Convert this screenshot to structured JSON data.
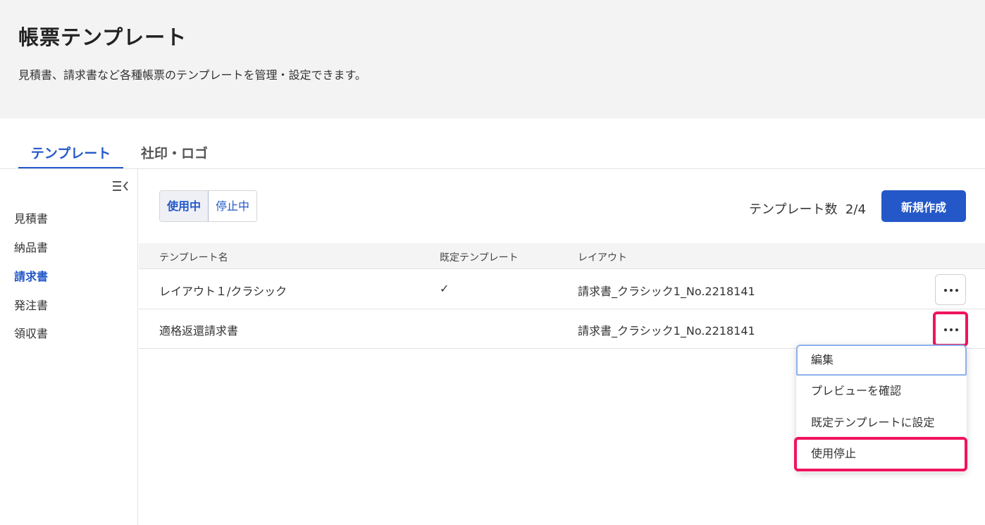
{
  "page": {
    "title": "帳票テンプレート",
    "description": "見積書、請求書など各種帳票のテンプレートを管理・設定できます。"
  },
  "tabs": [
    {
      "label": "テンプレート",
      "active": true
    },
    {
      "label": "社印・ロゴ",
      "active": false
    }
  ],
  "sidebar": {
    "collapse_icon": "collapse-sidebar-icon",
    "items": [
      {
        "label": "見積書",
        "active": false
      },
      {
        "label": "納品書",
        "active": false
      },
      {
        "label": "請求書",
        "active": true
      },
      {
        "label": "発注書",
        "active": false
      },
      {
        "label": "領収書",
        "active": false
      }
    ]
  },
  "status_toggle": {
    "active_label": "使用中",
    "inactive_label": "停止中",
    "selected": "使用中"
  },
  "template_count": {
    "label": "テンプレート数",
    "value": "2/4"
  },
  "new_button": {
    "label": "新規作成"
  },
  "table": {
    "columns": [
      "テンプレート名",
      "既定テンプレート",
      "レイアウト"
    ],
    "rows": [
      {
        "name": "レイアウト１/クラシック",
        "default": "✓",
        "layout": "請求書_クラシック1_No.2218141"
      },
      {
        "name": "適格返還請求書",
        "default": "",
        "layout": "請求書_クラシック1_No.2218141"
      }
    ]
  },
  "context_menu": {
    "items": [
      {
        "label": "編集"
      },
      {
        "label": "プレビューを確認"
      },
      {
        "label": "既定テンプレートに設定"
      },
      {
        "label": "使用停止"
      }
    ]
  },
  "colors": {
    "accent": "#2458c8",
    "highlight": "#f0145c",
    "header_bg": "#f4f3f4"
  }
}
